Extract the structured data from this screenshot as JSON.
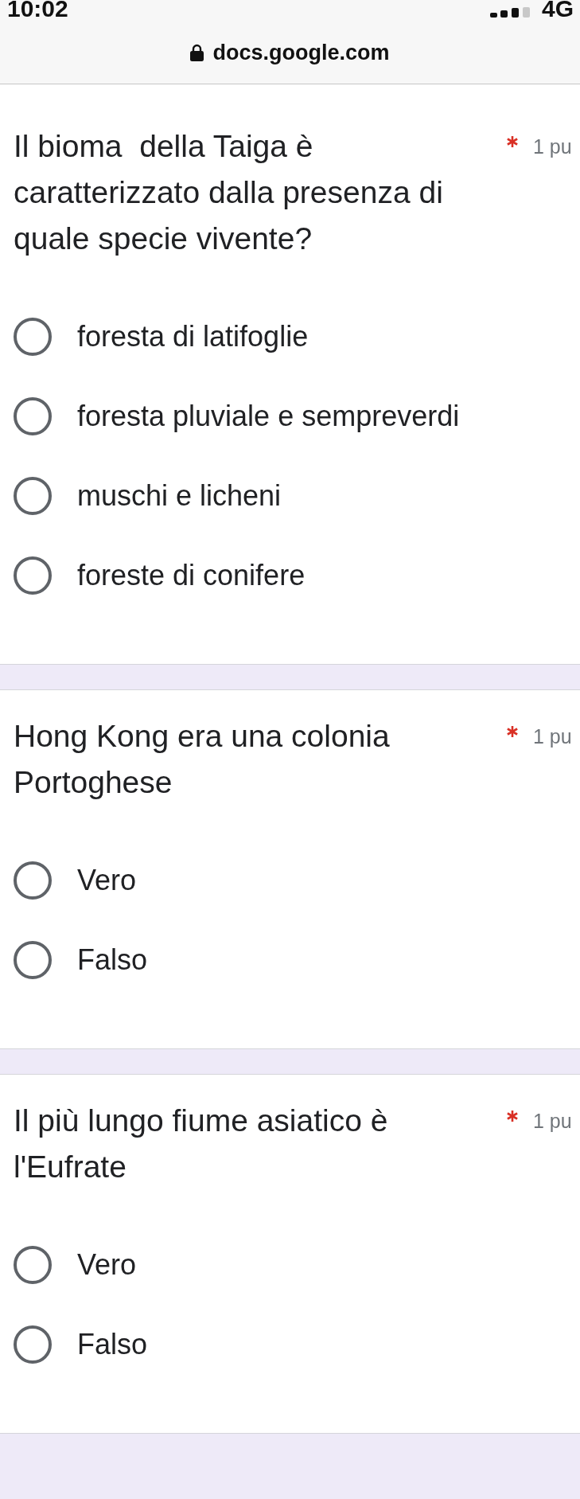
{
  "status_bar": {
    "time": "10:02",
    "network": "4G"
  },
  "address_bar": {
    "url": "docs.google.com",
    "secure": true
  },
  "questions": [
    {
      "title": "Il bioma  della Taiga è caratterizzato dalla presenza di quale specie vivente?",
      "required": true,
      "points": "1 pu",
      "options": [
        {
          "label": "foresta di latifoglie",
          "selected": false
        },
        {
          "label": "foresta pluviale e sempreverdi",
          "selected": false
        },
        {
          "label": "muschi e licheni",
          "selected": false
        },
        {
          "label": "foreste di conifere",
          "selected": false
        }
      ]
    },
    {
      "title": "Hong Kong era una colonia Portoghese",
      "required": true,
      "points": "1 pu",
      "options": [
        {
          "label": "Vero",
          "selected": false
        },
        {
          "label": "Falso",
          "selected": false
        }
      ]
    },
    {
      "title": "Il più lungo fiume asiatico è l'Eufrate",
      "required": true,
      "points": "1 pu",
      "options": [
        {
          "label": "Vero",
          "selected": false
        },
        {
          "label": "Falso",
          "selected": false
        }
      ]
    }
  ]
}
